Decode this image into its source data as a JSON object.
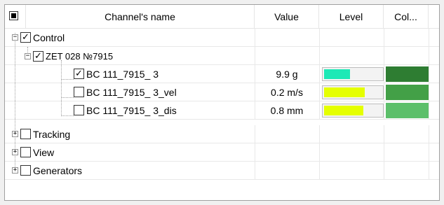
{
  "header": {
    "channel_name": "Channel's name",
    "value": "Value",
    "level": "Level",
    "color": "Col..."
  },
  "tree": {
    "control": {
      "label": "Control",
      "checked": true,
      "expanded": true
    },
    "device": {
      "label": "ZET 028 №7915",
      "checked": true,
      "expanded": true
    },
    "channels": [
      {
        "label": "BC 111_7915_ 3",
        "checked": true,
        "value": "9.9 g",
        "level": 0.46,
        "level_color": "#1de9b6",
        "channel_color": "#2e7d32"
      },
      {
        "label": "BC 111_7915_ 3_vel",
        "checked": false,
        "value": "0.2 m/s",
        "level": 0.72,
        "level_color": "#e5ff00",
        "channel_color": "#43a047"
      },
      {
        "label": "BC 111_7915_ 3_dis",
        "checked": false,
        "value": "0.8 mm",
        "level": 0.7,
        "level_color": "#e5ff00",
        "channel_color": "#5cbf6a"
      }
    ],
    "tracking": {
      "label": "Tracking",
      "checked": false,
      "expanded": false
    },
    "view": {
      "label": "View",
      "checked": false,
      "expanded": false
    },
    "generators": {
      "label": "Generators",
      "checked": false,
      "expanded": false
    }
  }
}
